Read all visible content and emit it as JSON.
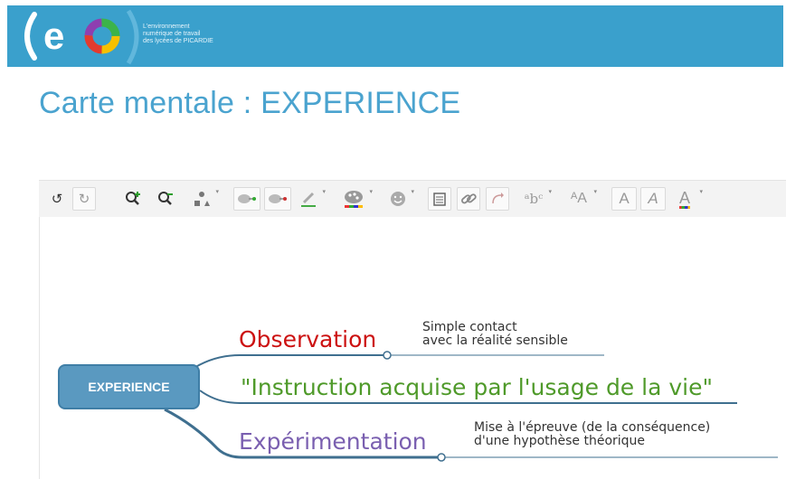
{
  "header": {
    "logo_letters": "(eo)",
    "logo_tagline": [
      "L'environnement",
      "numérique de travail",
      "des lycées de PICARDIE"
    ]
  },
  "page": {
    "title": "Carte mentale : EXPERIENCE"
  },
  "toolbar": {
    "tools": [
      {
        "name": "undo",
        "icon": "undo-icon"
      },
      {
        "name": "redo",
        "icon": "redo-icon"
      },
      {
        "name": "zoom-in",
        "icon": "zoom-in-icon"
      },
      {
        "name": "zoom-out",
        "icon": "zoom-out-icon"
      },
      {
        "name": "shape",
        "icon": "shape-icon"
      },
      {
        "name": "add-child",
        "icon": "add-topic-icon"
      },
      {
        "name": "delete-node",
        "icon": "delete-topic-icon"
      },
      {
        "name": "border-color",
        "icon": "pencil-icon"
      },
      {
        "name": "fill-color",
        "icon": "palette-icon"
      },
      {
        "name": "icon",
        "icon": "smiley-icon"
      },
      {
        "name": "note",
        "icon": "note-icon"
      },
      {
        "name": "link",
        "icon": "link-icon"
      },
      {
        "name": "relationship",
        "icon": "relationship-icon"
      },
      {
        "name": "font-family",
        "icon": "font-family-icon"
      },
      {
        "name": "font-size",
        "icon": "font-size-icon"
      },
      {
        "name": "bold",
        "icon": "bold-icon"
      },
      {
        "name": "italic",
        "icon": "italic-icon"
      },
      {
        "name": "font-color",
        "icon": "font-color-icon"
      }
    ],
    "glyphs": {
      "font_family": "ᵃbᶜ",
      "font_size": "ᴬA",
      "bold": "A",
      "italic": "A",
      "font_color": "A"
    }
  },
  "mindmap": {
    "central": "EXPERIENCE",
    "branches": [
      {
        "label": "Observation",
        "color": "#cc1111",
        "note_lines": [
          "Simple contact",
          "avec la réalité sensible"
        ]
      },
      {
        "label": "\"Instruction acquise par l'usage de la vie\"",
        "color": "#4f9a2a"
      },
      {
        "label": "Expérimentation",
        "color": "#7a5fb0",
        "note_lines": [
          "Mise à l'épreuve (de la conséquence)",
          "d'une hypothèse théorique"
        ]
      }
    ],
    "colors": {
      "central_fill": "#5a99c0",
      "connector": "#3f6f8f",
      "title": "#4aa3cf",
      "header": "#3aa0cc"
    }
  }
}
